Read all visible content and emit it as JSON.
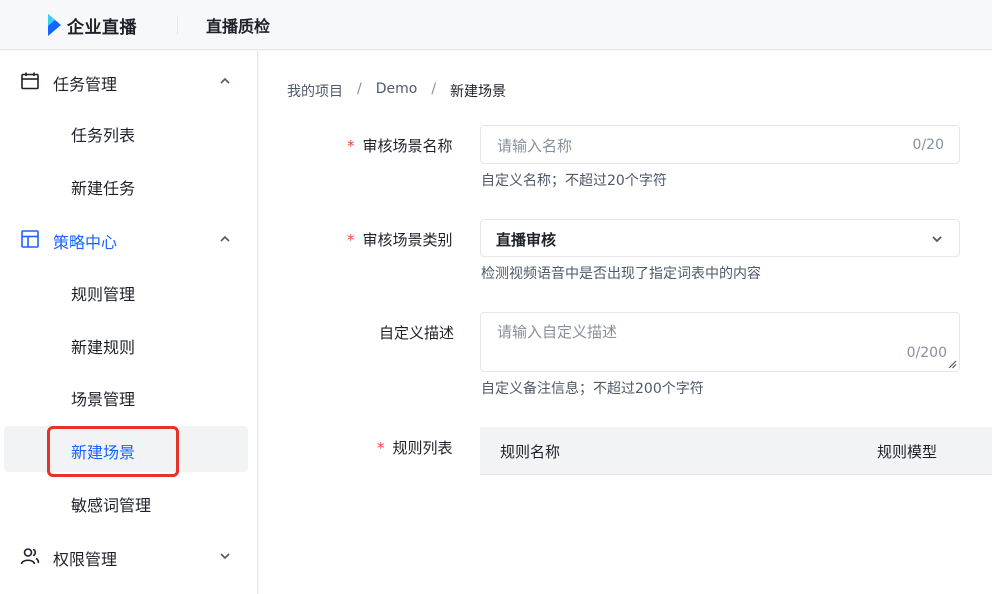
{
  "header": {
    "brand": "企业直播",
    "product": "直播质检",
    "brand_color": "#1664ff"
  },
  "sidebar": {
    "groups": [
      {
        "label": "任务管理",
        "icon": "calendar-icon",
        "expanded": true,
        "items": [
          {
            "label": "任务列表"
          },
          {
            "label": "新建任务"
          }
        ]
      },
      {
        "label": "策略中心",
        "icon": "layout-icon",
        "expanded": true,
        "active": true,
        "items": [
          {
            "label": "规则管理"
          },
          {
            "label": "新建规则"
          },
          {
            "label": "场景管理"
          },
          {
            "label": "新建场景",
            "selected": true
          },
          {
            "label": "敏感词管理"
          }
        ]
      },
      {
        "label": "权限管理",
        "icon": "users-icon",
        "expanded": false
      }
    ]
  },
  "breadcrumb": {
    "items": [
      "我的项目",
      "Demo",
      "新建场景"
    ],
    "separator": "/"
  },
  "form": {
    "name": {
      "label": "审核场景名称",
      "required_mark": "*",
      "placeholder": "请输入名称",
      "counter": "0/20",
      "hint": "自定义名称；不超过20个字符"
    },
    "category": {
      "label": "审核场景类别",
      "required_mark": "*",
      "value": "直播审核",
      "hint": "检测视频语音中是否出现了指定词表中的内容"
    },
    "description": {
      "label": "自定义描述",
      "placeholder": "请输入自定义描述",
      "counter": "0/200",
      "hint": "自定义备注信息；不超过200个字符"
    },
    "rules": {
      "label": "规则列表",
      "required_mark": "*",
      "columns": [
        "规则名称",
        "规则模型"
      ]
    }
  },
  "colors": {
    "accent": "#1664ff",
    "required": "#f53f3f",
    "highlight_border": "#e5322d"
  }
}
